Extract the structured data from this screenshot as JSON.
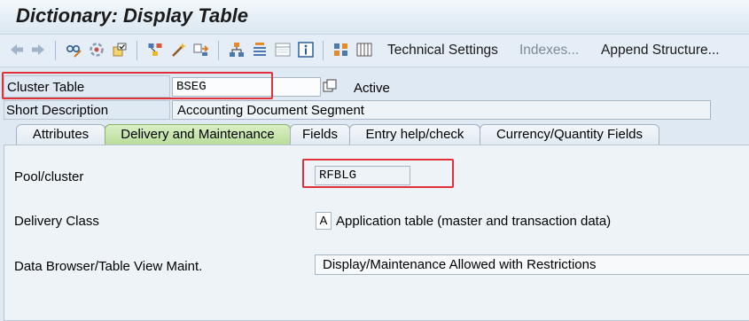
{
  "window": {
    "title": "Dictionary: Display Table"
  },
  "toolbar": {
    "icons": [
      "back-arrow-icon",
      "forward-arrow-icon",
      "glasses-pencil-icon",
      "other-object-icon",
      "activate-icon",
      "where-used-icon",
      "magic-wand-icon",
      "object-list-icon",
      "hierarchy-icon",
      "navigation-stack-icon",
      "display-list-icon",
      "info-icon",
      "contents-icon",
      "columns-icon"
    ],
    "technical_settings": "Technical Settings",
    "indexes": "Indexes...",
    "append_structure": "Append Structure..."
  },
  "header": {
    "cluster_table_label": "Cluster Table",
    "cluster_table_value": "BSEG",
    "status": "Active",
    "short_description_label": "Short Description",
    "short_description_value": "Accounting Document Segment"
  },
  "tabs": [
    {
      "label": "Attributes",
      "active": false
    },
    {
      "label": "Delivery and Maintenance",
      "active": true
    },
    {
      "label": "Fields",
      "active": false
    },
    {
      "label": "Entry help/check",
      "active": false
    },
    {
      "label": "Currency/Quantity Fields",
      "active": false
    }
  ],
  "delivery": {
    "pool_cluster_label": "Pool/cluster",
    "pool_cluster_value": "RFBLG",
    "delivery_class_label": "Delivery Class",
    "delivery_class_code": "A",
    "delivery_class_text": "Application table (master and transaction data)",
    "data_browser_label": "Data Browser/Table View Maint.",
    "data_browser_value": "Display/Maintenance Allowed with Restrictions"
  },
  "colors": {
    "highlight": "#e0303a",
    "active_tab": "#b9dc99",
    "background": "#dfe9f3"
  }
}
